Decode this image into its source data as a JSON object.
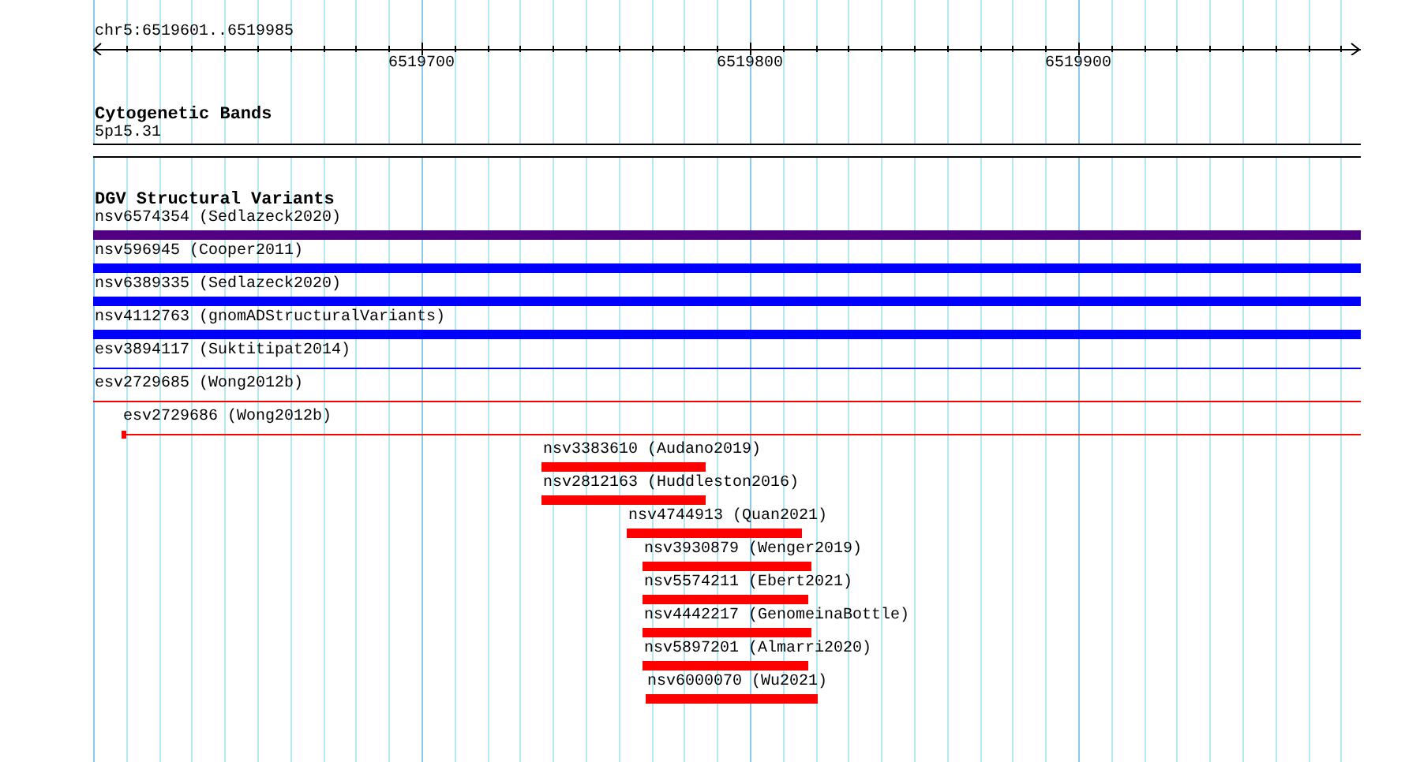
{
  "ruler": {
    "region": "chr5:6519601..6519985",
    "labels": [
      "6519700",
      "6519800",
      "6519900"
    ]
  },
  "tracks": [
    {
      "kind": "bands",
      "title": "Cytogenetic Bands",
      "features": [
        {
          "label": "5p15.31"
        }
      ]
    },
    {
      "kind": "variants",
      "title": "DGV Structural Variants",
      "features": [
        {
          "label": "nsv6574354 (Sedlazeck2020)",
          "color": "#500080",
          "kind": "thick"
        },
        {
          "label": "nsv596945 (Cooper2011)",
          "color": "#0000ff",
          "kind": "thick"
        },
        {
          "label": "nsv6389335 (Sedlazeck2020)",
          "color": "#0000ff",
          "kind": "thick"
        },
        {
          "label": "nsv4112763 (gnomADStructuralVariants)",
          "color": "#0000ff",
          "kind": "thick"
        },
        {
          "label": "esv3894117 (Suktitipat2014)",
          "color": "#0000ff",
          "kind": "line"
        },
        {
          "label": "esv2729685 (Wong2012b)",
          "color": "#ff0000",
          "kind": "line"
        },
        {
          "label": "esv2729686 (Wong2012b)",
          "color": "#ff0000",
          "kind": "marked"
        },
        {
          "label": "nsv3383610 (Audano2019)",
          "color": "#ff0000",
          "kind": "thick"
        },
        {
          "label": "nsv2812163 (Huddleston2016)",
          "color": "#ff0000",
          "kind": "thick"
        },
        {
          "label": "nsv4744913 (Quan2021)",
          "color": "#ff0000",
          "kind": "thick"
        },
        {
          "label": "nsv3930879 (Wenger2019)",
          "color": "#ff0000",
          "kind": "thick"
        },
        {
          "label": "nsv5574211 (Ebert2021)",
          "color": "#ff0000",
          "kind": "thick"
        },
        {
          "label": "nsv4442217 (GenomeinaBottle)",
          "color": "#ff0000",
          "kind": "thick"
        },
        {
          "label": "nsv5897201 (Almarri2020)",
          "color": "#ff0000",
          "kind": "thick"
        },
        {
          "label": "nsv6000070 (Wu2021)",
          "color": "#ff0000",
          "kind": "thick"
        }
      ]
    }
  ]
}
